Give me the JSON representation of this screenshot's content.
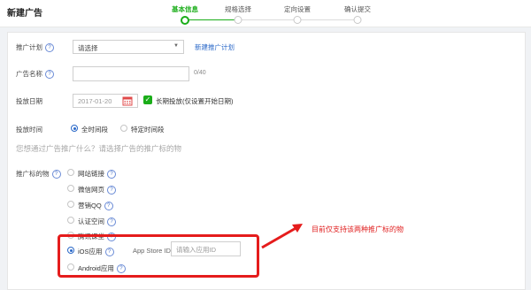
{
  "header": {
    "title": "新建广告",
    "steps": [
      {
        "label": "基本信息",
        "active": true
      },
      {
        "label": "规格选择",
        "active": false
      },
      {
        "label": "定向设置",
        "active": false
      },
      {
        "label": "确认提交",
        "active": false
      }
    ]
  },
  "form": {
    "plan": {
      "label": "推广计划",
      "help": "?",
      "value": "请选择",
      "link": "新建推广计划"
    },
    "ad_name": {
      "label": "广告名称",
      "help": "?",
      "value": "",
      "counter": "0/40"
    },
    "date": {
      "label": "投放日期",
      "value": "2017-01-20",
      "long_term_checked": true,
      "long_term_label": "长期投放(仅设置开始日期)"
    },
    "time": {
      "label": "投放时间",
      "options": [
        "全时间段",
        "特定时间段"
      ],
      "selected": 0
    },
    "hint": "您想通过广告推广什么？请选择广告的推广标的物",
    "target": {
      "label": "推广标的物",
      "help": "?",
      "options": [
        {
          "label": "网站链接",
          "help": "?"
        },
        {
          "label": "微信网页",
          "help": "?"
        },
        {
          "label": "营销QQ",
          "help": "?"
        },
        {
          "label": "认证空间",
          "help": "?"
        },
        {
          "label": "腾讯课堂",
          "help": "?"
        },
        {
          "label": "iOS应用",
          "help": "?",
          "selected": true
        },
        {
          "label": "Android应用",
          "help": "?"
        }
      ],
      "app_store_label": "App Store ID:",
      "app_store_placeholder": "请输入应用ID"
    }
  },
  "annotation": {
    "text": "目前仅支持该两种推广标的物",
    "color": "#e02020"
  },
  "colors": {
    "accent_green": "#1aad19",
    "link_blue": "#2a68c8",
    "annotation_red": "#e51c1c"
  }
}
